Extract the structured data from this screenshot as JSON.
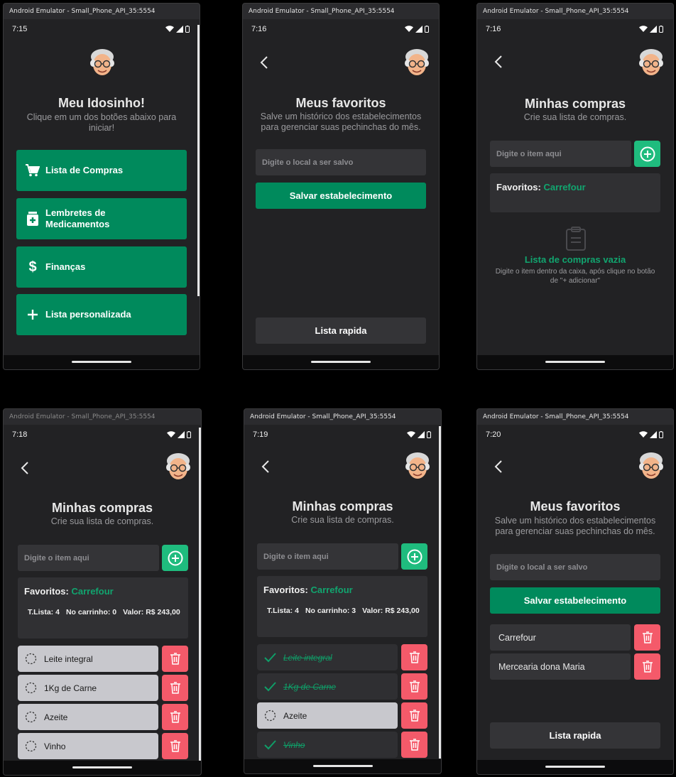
{
  "emulator_title": "Android Emulator - Small_Phone_API_35:5554",
  "screens": {
    "home": {
      "time": "7:15",
      "title": "Meu Idosinho!",
      "subtitle": "Clique em um dos botões abaixo para iniciar!",
      "buttons": [
        {
          "label": "Lista de Compras",
          "icon": "cart-icon"
        },
        {
          "label": "Lembretes de Medicamentos",
          "icon": "medicine-icon"
        },
        {
          "label": "Finanças",
          "icon": "dollar-icon"
        },
        {
          "label": "Lista personalizada",
          "icon": "plus-icon"
        }
      ]
    },
    "favorites_empty": {
      "time": "7:16",
      "title": "Meus favoritos",
      "subtitle": "Salve um histórico dos estabelecimentos para gerenciar suas pechinchas do mês.",
      "input_placeholder": "Digite o local a ser salvo",
      "save_label": "Salvar estabelecimento",
      "quick_list_label": "Lista rapida"
    },
    "shopping_empty": {
      "time": "7:16",
      "title": "Minhas compras",
      "subtitle": "Crie sua lista de compras.",
      "input_placeholder": "Digite o item aqui",
      "favorites_label": "Favoritos:",
      "favorite_store": "Carrefour",
      "empty_title": "Lista de compras vazia",
      "empty_subtitle": "Digite o item dentro da caixa, após clique no botão de \"+ adicionar\""
    },
    "shopping_list": {
      "time": "7:18",
      "title": "Minhas compras",
      "subtitle": "Crie sua lista de compras.",
      "input_placeholder": "Digite o item aqui",
      "favorites_label": "Favoritos:",
      "favorite_store": "Carrefour",
      "stats": {
        "total": "T.Lista: 4",
        "in_cart": "No carrinho: 0",
        "value": "Valor: R$ 243,00"
      },
      "items": [
        {
          "label": "Leite integral",
          "done": false
        },
        {
          "label": "1Kg de Carne",
          "done": false
        },
        {
          "label": "Azeite",
          "done": false
        },
        {
          "label": "Vinho",
          "done": false
        }
      ]
    },
    "shopping_checked": {
      "time": "7:19",
      "title": "Minhas compras",
      "subtitle": "Crie sua lista de compras.",
      "input_placeholder": "Digite o item aqui",
      "favorites_label": "Favoritos:",
      "favorite_store": "Carrefour",
      "stats": {
        "total": "T.Lista: 4",
        "in_cart": "No carrinho: 3",
        "value": "Valor: R$ 243,00"
      },
      "items": [
        {
          "label": "Leite integral",
          "done": true
        },
        {
          "label": "1Kg de Carne",
          "done": true
        },
        {
          "label": "Azeite",
          "done": false
        },
        {
          "label": "Vinho",
          "done": true
        }
      ]
    },
    "favorites_saved": {
      "time": "7:20",
      "title": "Meus favoritos",
      "subtitle": "Salve um histórico dos estabelecimentos para gerenciar suas pechinchas do mês.",
      "input_placeholder": "Digite o local a ser salvo",
      "save_label": "Salvar estabelecimento",
      "stores": [
        "Carrefour",
        "Mercearia dona Maria"
      ],
      "quick_list_label": "Lista rapida"
    }
  },
  "colors": {
    "accent_green": "#008a5c",
    "add_green": "#1fbc7e",
    "delete_red": "#f45a6a",
    "background": "#222224"
  }
}
